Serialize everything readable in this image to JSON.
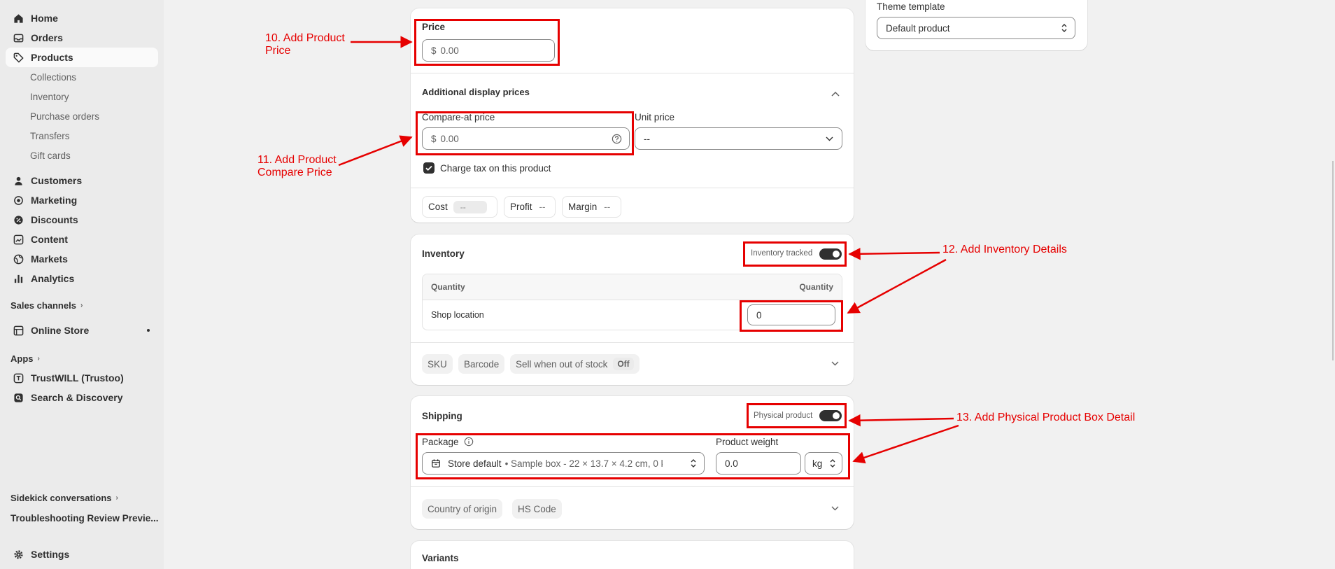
{
  "sidebar": {
    "nav": [
      {
        "label": "Home",
        "icon": "home-icon"
      },
      {
        "label": "Orders",
        "icon": "inbox-icon"
      },
      {
        "label": "Products",
        "icon": "tag-icon"
      }
    ],
    "product_sub": [
      "Collections",
      "Inventory",
      "Purchase orders",
      "Transfers",
      "Gift cards"
    ],
    "nav2": [
      {
        "label": "Customers",
        "icon": "person-icon"
      },
      {
        "label": "Marketing",
        "icon": "target-icon"
      },
      {
        "label": "Discounts",
        "icon": "discount-icon"
      },
      {
        "label": "Content",
        "icon": "content-icon"
      },
      {
        "label": "Markets",
        "icon": "globe-icon"
      },
      {
        "label": "Analytics",
        "icon": "chart-icon"
      }
    ],
    "sales_channels_label": "Sales channels",
    "online_store_label": "Online Store",
    "apps_label": "Apps",
    "apps": [
      "TrustWILL (Trustoo)",
      "Search & Discovery"
    ],
    "sidekick_label": "Sidekick conversations",
    "troubleshooting_label": "Troubleshooting Review Previe...",
    "settings_label": "Settings"
  },
  "theme": {
    "title": "Theme template",
    "value": "Default product"
  },
  "price": {
    "label": "Price",
    "currency": "$",
    "placeholder": "0.00",
    "additional_label": "Additional display prices",
    "compare_label": "Compare-at price",
    "compare_placeholder": "0.00",
    "unit_label": "Unit price",
    "unit_value": "--",
    "charge_tax_label": "Charge tax on this product",
    "cost_label": "Cost",
    "cost_value": "--",
    "profit_label": "Profit",
    "profit_value": "--",
    "margin_label": "Margin",
    "margin_value": "--"
  },
  "inventory": {
    "title": "Inventory",
    "tracked_label": "Inventory tracked",
    "col_left": "Quantity",
    "col_right": "Quantity",
    "location": "Shop location",
    "quantity": "0",
    "sku": "SKU",
    "barcode": "Barcode",
    "sell_oos": "Sell when out of stock",
    "sell_oos_value": "Off"
  },
  "shipping": {
    "title": "Shipping",
    "physical_label": "Physical product",
    "package_label": "Package",
    "package_value": "Store default",
    "package_detail": "• Sample box - 22 × 13.7 × 4.2 cm, 0 k",
    "weight_label": "Product weight",
    "weight_value": "0.0",
    "weight_unit": "kg",
    "country": "Country of origin",
    "hs_code": "HS Code"
  },
  "variants": {
    "title": "Variants"
  },
  "annotations": {
    "a10": [
      "10. Add Product",
      "Price"
    ],
    "a11": [
      "11. Add Product",
      "Compare Price"
    ],
    "a12": "12. Add Inventory Details",
    "a13": "13. Add Physical Product Box Detail"
  },
  "colors": {
    "annotation": "#e60000",
    "toggle": "#303030"
  }
}
